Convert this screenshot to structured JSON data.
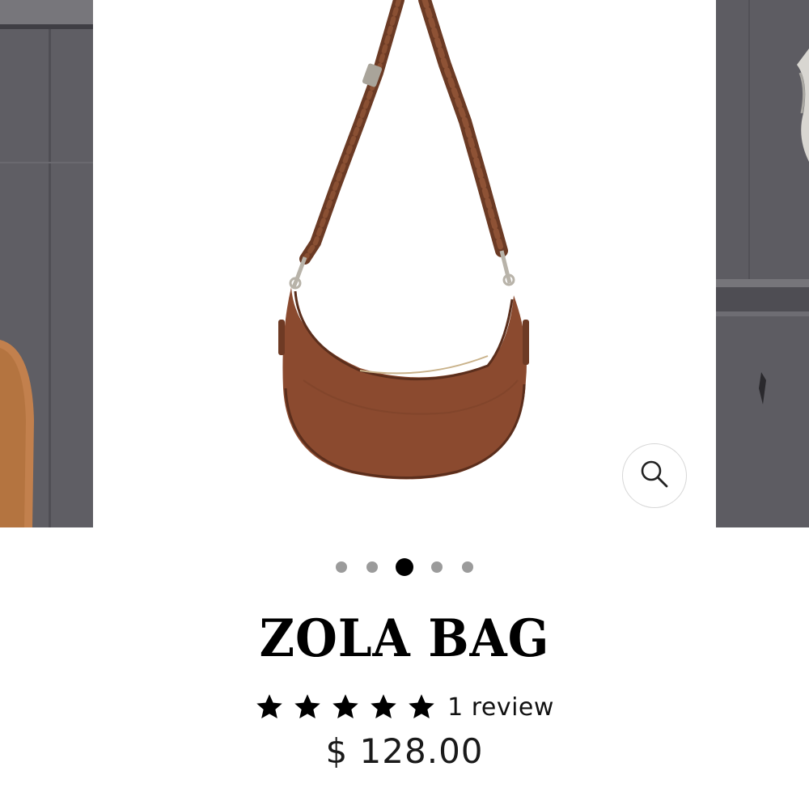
{
  "product": {
    "title": "ZOLA BAG",
    "rating": 5,
    "rating_max": 5,
    "review_label": "1 review",
    "price": "$ 128.00"
  },
  "gallery": {
    "slide_count": 5,
    "active_index": 2,
    "zoom_icon": "magnifier-icon"
  },
  "colors": {
    "leather": "#8a4a2e",
    "wall": "#5e5d63",
    "active_dot": "#000000",
    "inactive_dot": "#9b9b9b"
  }
}
